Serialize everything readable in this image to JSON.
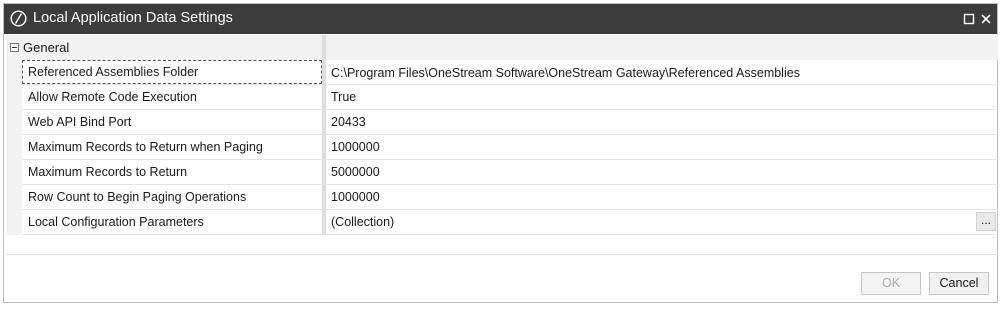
{
  "window": {
    "title": "Local Application Data Settings",
    "icons": {
      "logo": "onestream-logo-icon",
      "maximize": "maximize-icon",
      "close": "close-icon"
    }
  },
  "category": {
    "label": "General",
    "expanded": true
  },
  "properties": [
    {
      "name": "Referenced Assemblies Folder",
      "value": "C:\\Program Files\\OneStream Software\\OneStream Gateway\\Referenced Assemblies"
    },
    {
      "name": "Allow Remote Code Execution",
      "value": "True"
    },
    {
      "name": "Web API Bind Port",
      "value": "20433"
    },
    {
      "name": "Maximum Records to Return when Paging",
      "value": "1000000"
    },
    {
      "name": "Maximum Records to Return",
      "value": "5000000"
    },
    {
      "name": "Row Count to Begin Paging Operations",
      "value": "1000000"
    },
    {
      "name": "Local Configuration Parameters",
      "value": "(Collection)",
      "ellipsis": "..."
    }
  ],
  "buttons": {
    "ok": "OK",
    "cancel": "Cancel",
    "ok_enabled": false
  },
  "colors": {
    "titlebar": "#3c3c3c",
    "category_bg": "#f2f2f2",
    "disabled_text": "#a8a8a8"
  }
}
